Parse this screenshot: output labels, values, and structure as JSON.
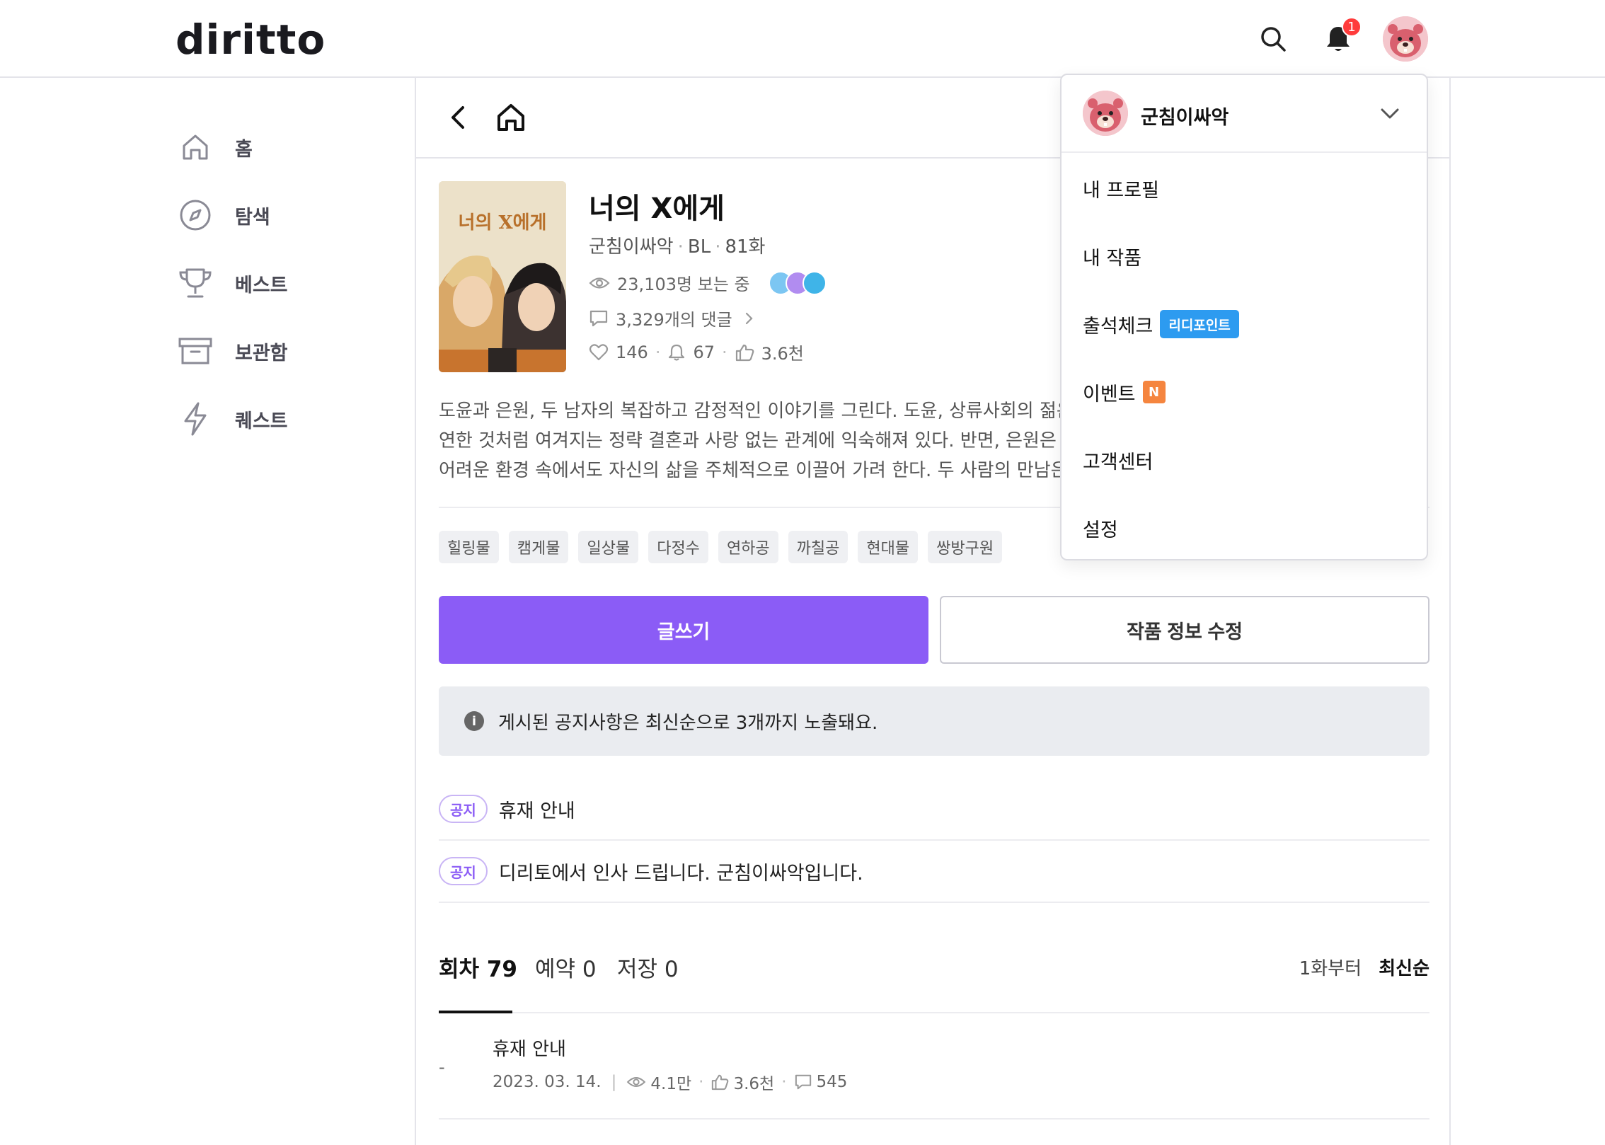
{
  "header": {
    "logo": "diritto",
    "notification_count": "1"
  },
  "sidebar": {
    "items": [
      {
        "label": "홈",
        "icon": "home-icon"
      },
      {
        "label": "탐색",
        "icon": "compass-icon"
      },
      {
        "label": "베스트",
        "icon": "trophy-icon"
      },
      {
        "label": "보관함",
        "icon": "archive-icon"
      },
      {
        "label": "퀘스트",
        "icon": "lightning-icon"
      }
    ]
  },
  "work": {
    "cover_title": "너의 X에게",
    "title": "너의 X에게",
    "author": "군침이싸악",
    "genre": "BL",
    "episodes": "81화",
    "readers": "23,103명 보는 중",
    "comments": "3,329개의 댓글",
    "likes": "146",
    "alarms": "67",
    "thumbs": "3.6천",
    "description": [
      "도윤과 은원, 두 남자의 복잡하고 감정적인 이야기를 그린다. 도윤, 상류사회의 젊은",
      "연한 것처럼 여겨지는 정략 결혼과 사랑 없는 관계에 익숙해져 있다. 반면, 은원은 경",
      "어려운 환경 속에서도 자신의 삶을 주체적으로 이끌어 가려 한다. 두 사람의 만남은"
    ],
    "tags": [
      "힐링물",
      "캠게물",
      "일상물",
      "다정수",
      "연하공",
      "까칠공",
      "현대물",
      "쌍방구원"
    ]
  },
  "actions": {
    "write": "글쓰기",
    "edit": "작품 정보 수정"
  },
  "info_box": "게시된 공지사항은 최신순으로 3개까지 노출돼요.",
  "notices": [
    {
      "badge": "공지",
      "text": "휴재 안내"
    },
    {
      "badge": "공지",
      "text": "디리토에서 인사 드립니다. 군침이싸악입니다."
    }
  ],
  "tabs": {
    "episodes": "회차 79",
    "reserved": "예약 0",
    "saved": "저장 0",
    "sort_first": "1화부터",
    "sort_latest": "최신순"
  },
  "episode_list": [
    {
      "dash": "-",
      "title": "휴재 안내",
      "date": "2023. 03. 14.",
      "views": "4.1만",
      "likes": "3.6천",
      "comments": "545"
    }
  ],
  "dropdown": {
    "username": "군침이싸악",
    "items": [
      {
        "label": "내 프로필"
      },
      {
        "label": "내 작품"
      },
      {
        "label": "출석체크",
        "badge": "리디포인트"
      },
      {
        "label": "이벤트",
        "badge": "N"
      },
      {
        "label": "고객센터"
      },
      {
        "label": "설정"
      }
    ]
  },
  "colors": {
    "accent": "#8b5cf6",
    "badge_blue": "#2d9bf0",
    "badge_orange": "#f5853f",
    "notif_red": "#ff3b3b"
  }
}
